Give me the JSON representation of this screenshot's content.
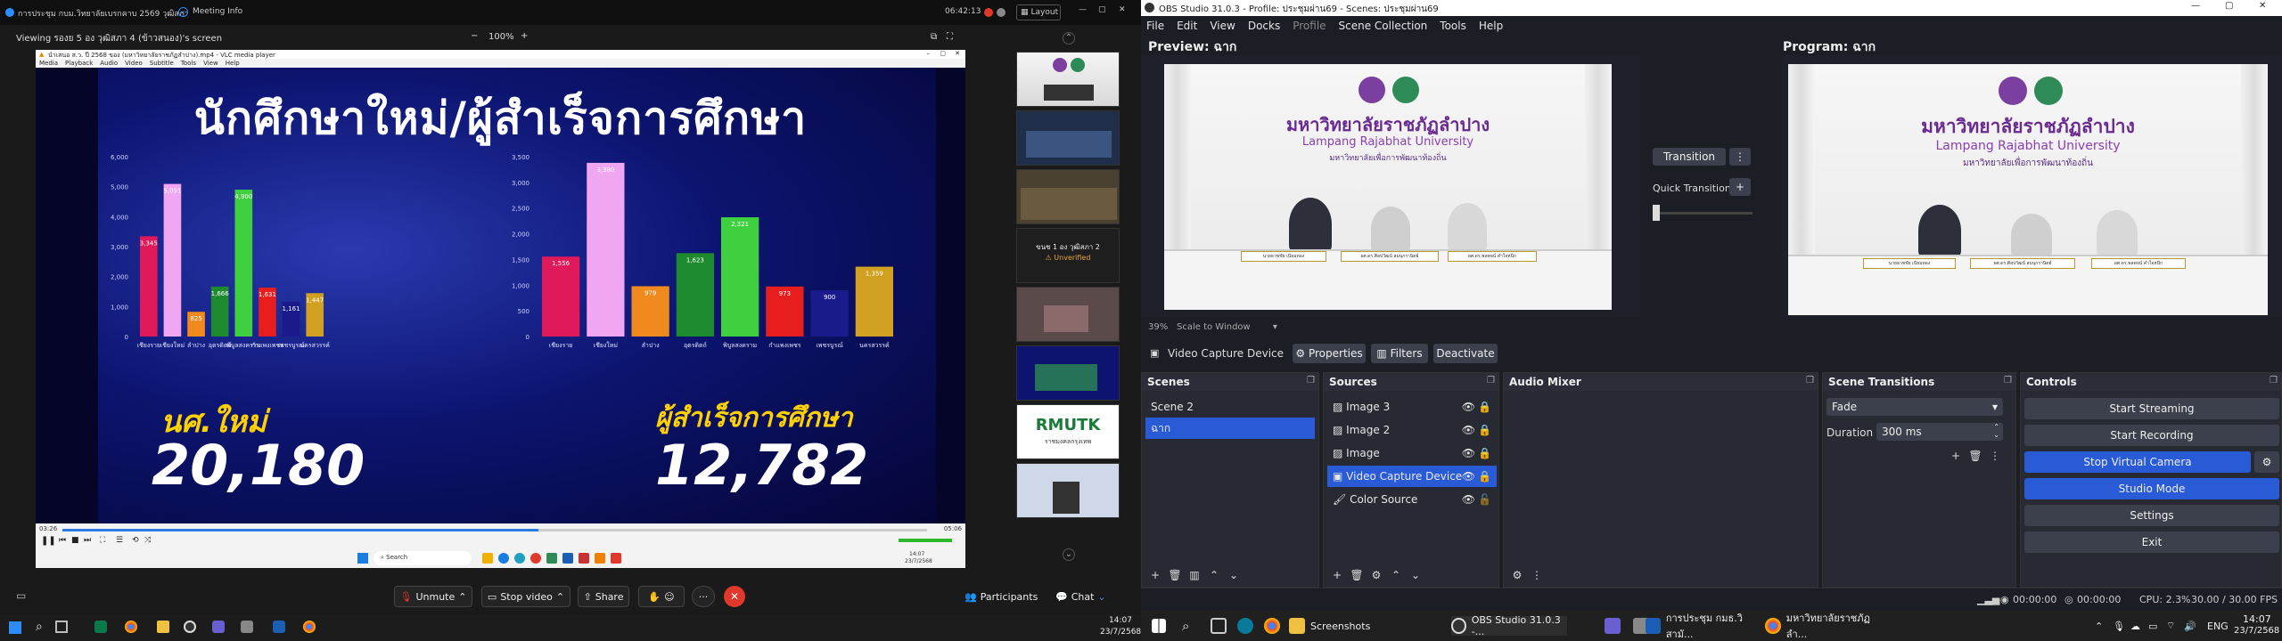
{
  "zoom": {
    "top_left": "การประชุม กบม.วิทยาลัยเบรกคาบ 2569 วุฒิสภา",
    "meeting_info": "Meeting Info",
    "time": "06:42:13",
    "layout": "Layout",
    "viewing": "Viewing รองย 5 อง วุฒิสภา 4 (ข้าวสนอง)'s screen",
    "zoom_level": "100%",
    "vlc_title": "นำเสนอ ส.ว. ปี 2568 ของ (มหาวิทยาลัยราชภัฏลำปาง).mp4 - VLC media player",
    "vlc_menu": [
      "Media",
      "Playback",
      "Audio",
      "Video",
      "Subtitle",
      "Tools",
      "View",
      "Help"
    ],
    "slide_title": "นักศึกษาใหม่/ผู้สำเร็จการศึกษา",
    "new_students_label": "นศ.ใหม่",
    "new_students_total": "20,180",
    "graduates_label": "ผู้สำเร็จการศึกษา",
    "graduates_total": "12,782",
    "vlc_time_left": "03:26",
    "vlc_time_right": "05:06",
    "inner_task_search": "Search",
    "inner_clock_time": "14:07",
    "inner_clock_date": "23/7/2568",
    "strip_name": "ขนช 1 อง วุฒิสภา 2",
    "strip_unverified": "Unverified",
    "strip_logo": "RMUTK",
    "strip_logo_sub": "ราชมงคลกรุงเทพ",
    "unmute": "Unmute",
    "stop_video": "Stop video",
    "share": "Share",
    "participants": "Participants",
    "chat": "Chat",
    "clock_time": "14:07",
    "clock_date": "23/7/2568"
  },
  "chart_data": [
    {
      "type": "bar",
      "title": "",
      "ylim": [
        0,
        6000
      ],
      "yticks": [
        "6,000",
        "5,000",
        "4,000",
        "3,000",
        "2,000",
        "1,000",
        "0"
      ],
      "categories": [
        "เชียงราย",
        "เชียงใหม่",
        "ลำปาง",
        "อุตรดิตถ์",
        "พิบูลสงคราม",
        "กำแพงเพชร",
        "เพชรบูรณ์",
        "นครสวรรค์"
      ],
      "values": [
        3345,
        5091,
        825,
        1666,
        4900,
        1631,
        1161,
        1447
      ],
      "value_labels": [
        "3,345",
        "5,091",
        "825",
        "1,666",
        "4,900",
        "1,631",
        "1,161",
        "1,447"
      ],
      "colors": [
        "#e0195a",
        "#f0a6f0",
        "#f08a1e",
        "#1e8a2e",
        "#3fd040",
        "#e81e1e",
        "#1a1a8c",
        "#d1a020"
      ]
    },
    {
      "type": "bar",
      "title": "",
      "ylim": [
        0,
        3500
      ],
      "yticks": [
        "3,500",
        "3,000",
        "2,500",
        "2,000",
        "1,500",
        "1,000",
        "500",
        "0"
      ],
      "categories": [
        "เชียงราย",
        "เชียงใหม่",
        "ลำปาง",
        "อุตรดิตถ์",
        "พิบูลสงคราม",
        "กำแพงเพชร",
        "เพชรบูรณ์",
        "นครสวรรค์"
      ],
      "values": [
        1556,
        3380,
        979,
        1623,
        2321,
        973,
        900,
        1359
      ],
      "value_labels": [
        "1,556",
        "3,380",
        "979",
        "1,623",
        "2,321",
        "973",
        "900",
        "1,359"
      ],
      "colors": [
        "#e0195a",
        "#f0a6f0",
        "#f08a1e",
        "#1e8a2e",
        "#3fd040",
        "#e81e1e",
        "#1a1a8c",
        "#d1a020"
      ]
    }
  ],
  "obs": {
    "title": "OBS Studio 31.0.3 - Profile: ประชุมผ่าน69 - Scenes: ประชุมผ่าน69",
    "menu": [
      "File",
      "Edit",
      "View",
      "Docks",
      "Profile",
      "Scene Collection",
      "Tools",
      "Help"
    ],
    "preview_label": "Preview: ฉาก",
    "program_label": "Program: ฉาก",
    "zoom_pct": "39%",
    "scale_label": "Scale to Window",
    "transition": "Transition",
    "quick_transitions": "Quick Transitions",
    "uni_th": "มหาวิทยาลัยราชภัฏลำปาง",
    "uni_en": "Lampang Rajabhat University",
    "uni_sub": "มหาวิทยาลัยเพื่อการพัฒนาท้องถิ่น",
    "nameplates": [
      "นายธวชชัย เนียมทอง",
      "ผศ.ดร.ศิลปวัฒน์ สมนุกรานิตย์",
      "ผศ.ดร.พลพจน์ คำใจหนึก"
    ],
    "source_bar": {
      "name": "Video Capture Device",
      "properties": "Properties",
      "filters": "Filters",
      "deactivate": "Deactivate"
    },
    "scenes_title": "Scenes",
    "scenes": [
      "Scene 2",
      "ฉาก"
    ],
    "sources_title": "Sources",
    "sources": [
      "Image 3",
      "Image 2",
      "Image",
      "Video Capture Device",
      "Color Source"
    ],
    "mixer_title": "Audio Mixer",
    "transitions_title": "Scene Transitions",
    "transition_value": "Fade",
    "duration_label": "Duration",
    "duration_value": "300 ms",
    "controls_title": "Controls",
    "controls": [
      "Start Streaming",
      "Start Recording",
      "Stop Virtual Camera",
      "Studio Mode",
      "Settings",
      "Exit"
    ],
    "status_time1": "00:00:00",
    "status_time2": "00:00:00",
    "cpu": "CPU: 2.3%",
    "fps": "30.00 / 30.00 FPS"
  },
  "taskbar": {
    "screenshots": "Screenshots",
    "obs": "OBS Studio 31.0.3 -...",
    "meeting": "การประชุม กมธ.วิสามั...",
    "browser": "มหาวิทยาลัยราชภัฏลำ...",
    "lang": "ENG",
    "time": "14:07",
    "date": "23/7/2568"
  }
}
